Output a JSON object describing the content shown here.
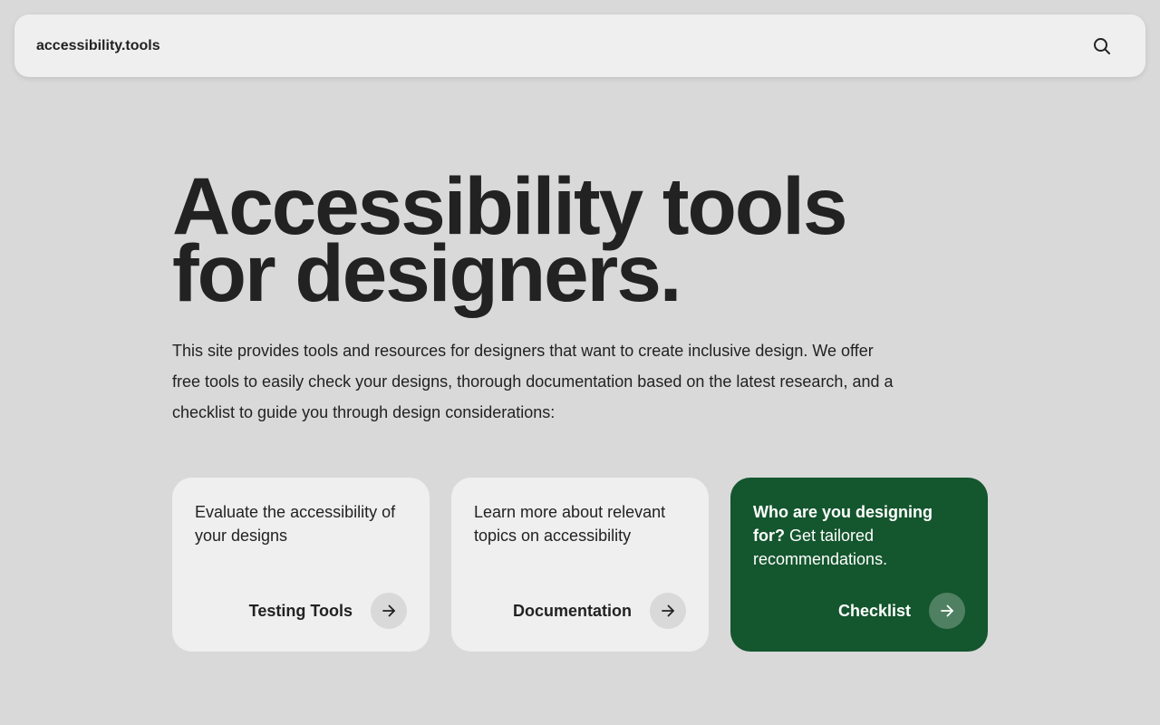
{
  "header": {
    "brand": "accessibility.tools",
    "search_icon": "search-icon"
  },
  "hero": {
    "title": "Accessibility tools for designers.",
    "intro": "This site provides tools and resources for designers that want to create inclusive design. We offer free tools to easily check your designs, thorough documentation based on the latest research, and a checklist to guide you through design considerations:"
  },
  "cards": [
    {
      "description": "Evaluate the accessibility of your designs",
      "link": "Testing Tools",
      "icon": "arrow-right-icon"
    },
    {
      "description": "Learn more about relevant topics on accessibility",
      "link": "Documentation",
      "icon": "arrow-right-icon"
    },
    {
      "description_bold": "Who are you designing for?",
      "description": " Get tailored recommendations.",
      "link": "Checklist",
      "icon": "arrow-right-icon"
    }
  ],
  "colors": {
    "background": "#d9d9d9",
    "surface": "#efefef",
    "text": "#222222",
    "accent_green": "#14562e"
  }
}
